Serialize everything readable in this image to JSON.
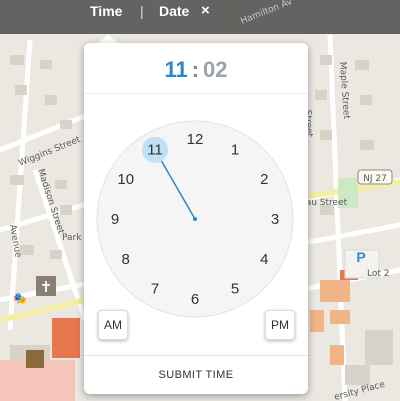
{
  "topbar": {
    "tab_time": "Time",
    "separator": "|",
    "tab_date": "Date",
    "close": "×"
  },
  "picker": {
    "hour": "11",
    "separator": ":",
    "minute": "02",
    "selected_hour": 11,
    "dial_numbers": [
      "12",
      "1",
      "2",
      "3",
      "4",
      "5",
      "6",
      "7",
      "8",
      "9",
      "10",
      "11"
    ],
    "am_label": "AM",
    "pm_label": "PM",
    "submit_label": "SUBMIT TIME",
    "accent_color": "#2f86c3",
    "highlight_color": "#bfe0f5"
  },
  "map": {
    "street_labels": [
      "Hamilton Av",
      "Wiggins Street",
      "Madison Street",
      "Park",
      "Maple Street",
      "NJ 27",
      "nau Street",
      "Lot 2",
      "Street",
      "Avenue",
      "ersity Place"
    ],
    "parking_label": "P"
  }
}
